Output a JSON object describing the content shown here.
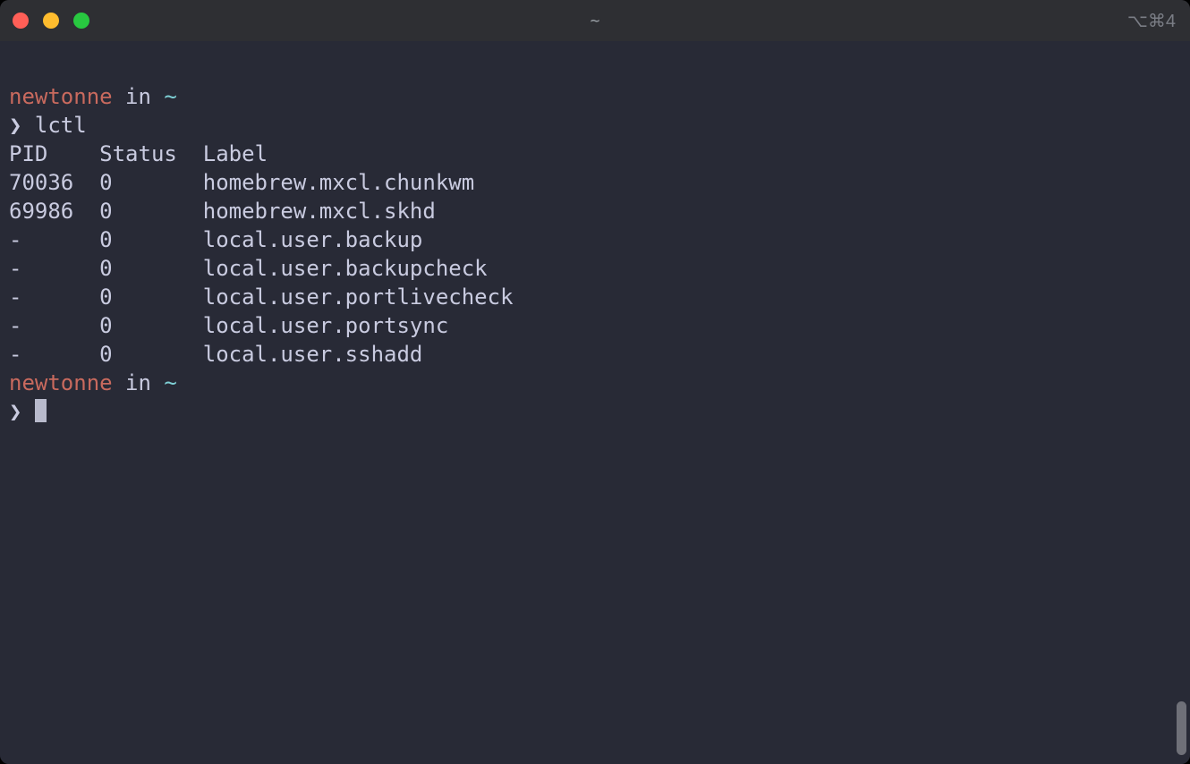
{
  "window": {
    "title": "~",
    "shortcut_hint": "⌥⌘4"
  },
  "prompt1": {
    "user": "newtonne",
    "in": " in ",
    "path": "~",
    "arrow": "❯",
    "command": "lctl"
  },
  "output": {
    "header": {
      "pid": "PID",
      "status": "Status",
      "label": "Label"
    },
    "rows": [
      {
        "pid": "70036",
        "status": "0",
        "label": "homebrew.mxcl.chunkwm"
      },
      {
        "pid": "69986",
        "status": "0",
        "label": "homebrew.mxcl.skhd"
      },
      {
        "pid": "-",
        "status": "0",
        "label": "local.user.backup"
      },
      {
        "pid": "-",
        "status": "0",
        "label": "local.user.backupcheck"
      },
      {
        "pid": "-",
        "status": "0",
        "label": "local.user.portlivecheck"
      },
      {
        "pid": "-",
        "status": "0",
        "label": "local.user.portsync"
      },
      {
        "pid": "-",
        "status": "0",
        "label": "local.user.sshadd"
      }
    ]
  },
  "prompt2": {
    "user": "newtonne",
    "in": " in ",
    "path": "~",
    "arrow": "❯"
  }
}
